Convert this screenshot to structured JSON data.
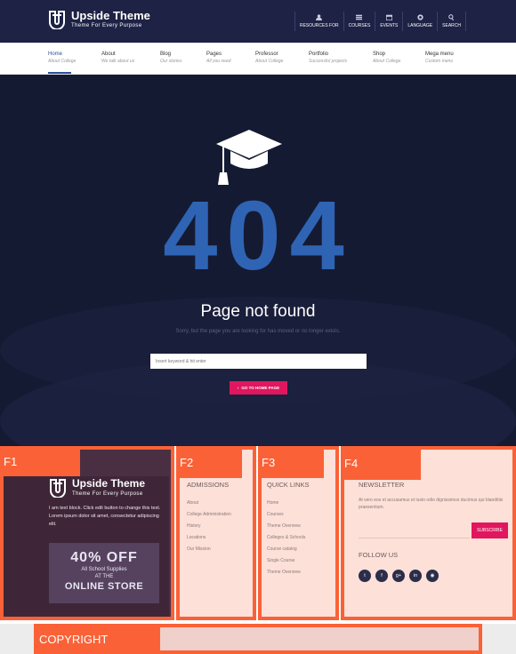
{
  "header": {
    "logo_title": "Upside Theme",
    "logo_tagline": "Theme For Every Purpose",
    "top_menu": [
      {
        "icon": "user-icon",
        "label": "RESOURCES FOR"
      },
      {
        "icon": "list-icon",
        "label": "COURSES"
      },
      {
        "icon": "calendar-icon",
        "label": "EVENTS"
      },
      {
        "icon": "globe-icon",
        "label": "LANGUAGE"
      },
      {
        "icon": "search-icon",
        "label": "SEARCH"
      }
    ]
  },
  "nav": [
    {
      "label": "Home",
      "sub": "About College"
    },
    {
      "label": "About",
      "sub": "We talk about us"
    },
    {
      "label": "Blog",
      "sub": "Our stories"
    },
    {
      "label": "Pages",
      "sub": "All you need"
    },
    {
      "label": "Professor",
      "sub": "About College"
    },
    {
      "label": "Portfolio",
      "sub": "Successful projects"
    },
    {
      "label": "Shop",
      "sub": "About College"
    },
    {
      "label": "Mega menu",
      "sub": "Custom menu"
    }
  ],
  "hero": {
    "code": "404",
    "title": "Page not found",
    "message": "Sorry, but the page you are looking for has moved or no longer exists.",
    "search_placeholder": "Insert keyword & hit enter",
    "button_label": "GO TO HOME PAGE"
  },
  "footer": {
    "f1": {
      "tag": "F1",
      "logo_title": "Upside Theme",
      "logo_tagline": "Theme For Every Purpose",
      "text": "I am text block. Click edit button to change this text. Lorem ipsum dolor sit amet, consectetur adipiscing elit.",
      "promo": {
        "off": "40% OFF",
        "line1": "All School Supplies",
        "line2": "AT THE",
        "store": "ONLINE STORE"
      }
    },
    "f2": {
      "tag": "F2",
      "title": "ADMISSIONS",
      "links": [
        "About",
        "College Administration",
        "History",
        "Locations",
        "Our Mission"
      ]
    },
    "f3": {
      "tag": "F3",
      "title": "QUICK LINKS",
      "links": [
        "Home",
        "Courses",
        "Theme Overview",
        "Colleges & Schools",
        "Course catalog",
        "Single Course",
        "Theme Overview"
      ]
    },
    "f4": {
      "tag": "F4",
      "title": "NEWSLETTER",
      "text": "At vero eos et accusamus et iusto odio dignissimos ducimus qui blanditiis praesentium.",
      "subscribe_label": "SUBSCRIBE",
      "follow_title": "FOLLOW US",
      "socials": [
        {
          "icon": "twitter-icon",
          "glyph": "t"
        },
        {
          "icon": "facebook-icon",
          "glyph": "f"
        },
        {
          "icon": "google-plus-icon",
          "glyph": "g+"
        },
        {
          "icon": "linkedin-icon",
          "glyph": "in"
        },
        {
          "icon": "dribbble-icon",
          "glyph": "◉"
        }
      ]
    },
    "copyright_label": "COPYRIGHT"
  },
  "colors": {
    "header_bg": "#1e2245",
    "accent_blue": "#2f64b4",
    "accent_pink": "#e0175e",
    "label_orange": "#fb6137"
  }
}
